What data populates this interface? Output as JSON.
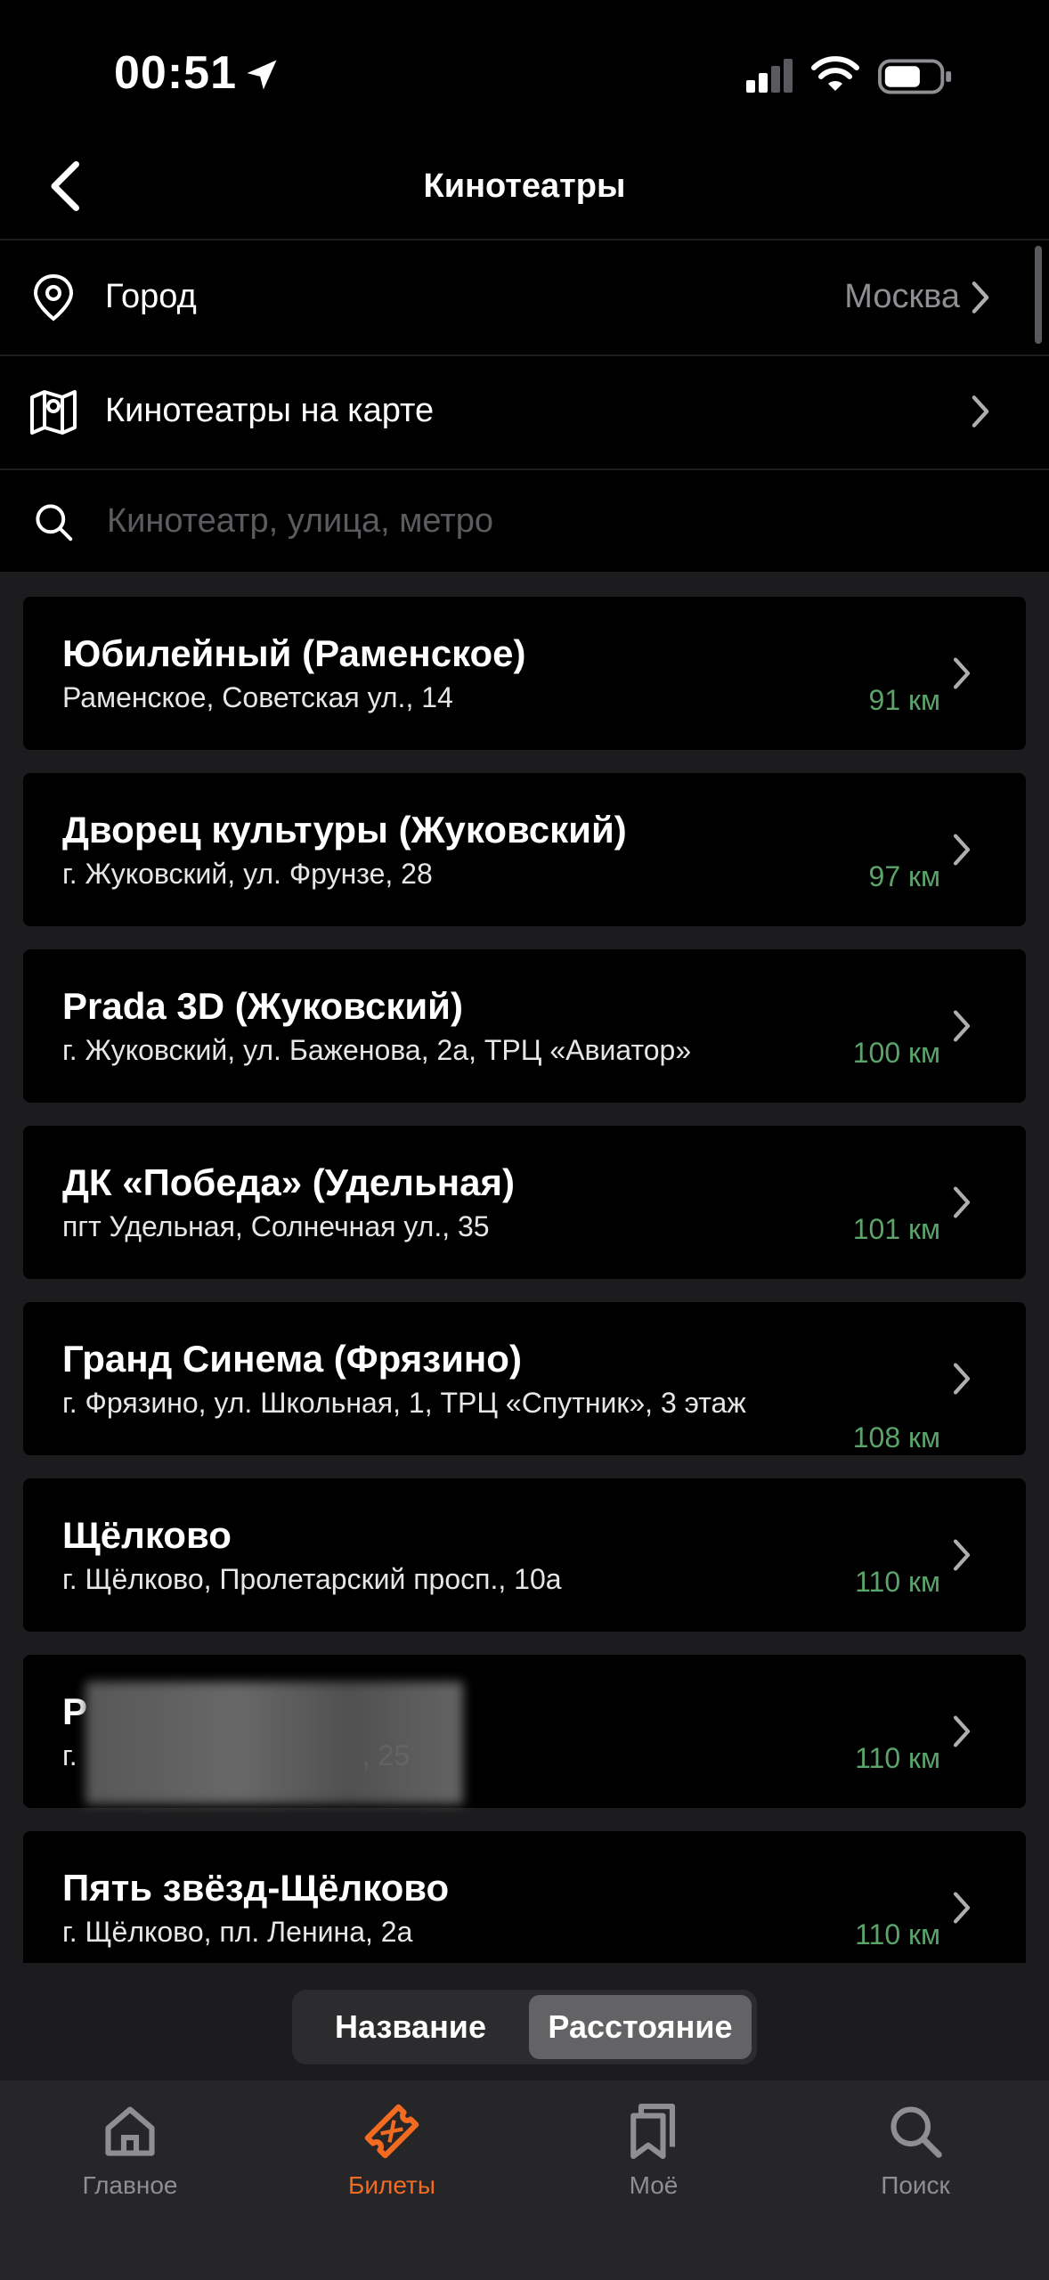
{
  "status_bar": {
    "time": "00:51"
  },
  "nav": {
    "title": "Кинотеатры"
  },
  "city_row": {
    "label": "Город",
    "value": "Москва"
  },
  "map_row": {
    "label": "Кинотеатры на карте"
  },
  "search": {
    "placeholder": "Кинотеатр, улица, метро"
  },
  "cinemas": [
    {
      "name": "Юбилейный (Раменское)",
      "address": "Раменское, Советская ул., 14",
      "distance": "91 км"
    },
    {
      "name": "Дворец культуры (Жуковский)",
      "address": "г. Жуковский, ул. Фрунзе, 28",
      "distance": "97 км"
    },
    {
      "name": "Prada 3D (Жуковский)",
      "address": "г. Жуковский, ул. Баженова, 2а, ТРЦ «Авиатор»",
      "distance": "100 км"
    },
    {
      "name": "ДК «Победа» (Удельная)",
      "address": "пгт Удельная, Солнечная ул., 35",
      "distance": "101 км"
    },
    {
      "name": "Гранд Синема (Фрязино)",
      "address": "г. Фрязино, ул. Школьная, 1, ТРЦ «Спутник», 3 этаж",
      "distance": "108 км"
    },
    {
      "name": "Щёлково",
      "address": "г. Щёлково, Пролетарский просп., 10а",
      "distance": "110 км"
    },
    {
      "name": "Р",
      "address": "г.                                    , 25",
      "distance": "110 км"
    },
    {
      "name": "Пять звёзд-Щёлково",
      "address": "г. Щёлково, пл. Ленина, 2а",
      "distance": "110 км"
    }
  ],
  "sort": {
    "options": [
      "Название",
      "Расстояние"
    ],
    "selected": "Расстояние"
  },
  "tabs": [
    {
      "label": "Главное",
      "icon": "home-icon"
    },
    {
      "label": "Билеты",
      "icon": "ticket-icon",
      "active": true
    },
    {
      "label": "Моё",
      "icon": "bookmarks-icon"
    },
    {
      "label": "Поиск",
      "icon": "search-icon"
    }
  ],
  "colors": {
    "accent": "#f26b21",
    "distance": "#5aa46a",
    "background": "#000000",
    "list_bg": "#1c1c1e"
  }
}
